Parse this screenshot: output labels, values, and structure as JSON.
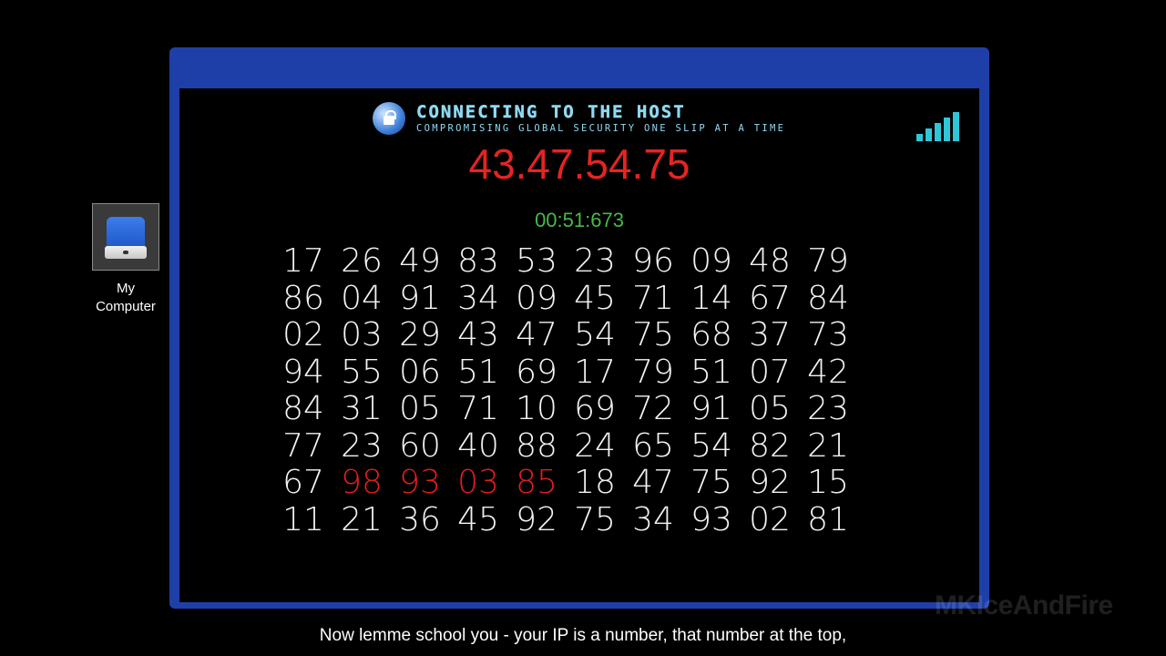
{
  "desktop": {
    "icon_name": "drive-icon",
    "label_line1": "My",
    "label_line2": "Computer"
  },
  "header": {
    "title": "CONNECTING TO THE HOST",
    "subtitle": "COMPROMISING GLOBAL SECURITY ONE SLIP AT A TIME"
  },
  "signal": {
    "bars": 5,
    "color": "#2ec7d8"
  },
  "target_ip": "43.47.54.75",
  "timer": "00:51:673",
  "grid": {
    "rows": [
      [
        "17",
        "26",
        "49",
        "83",
        "53",
        "23",
        "96",
        "09",
        "48",
        "79"
      ],
      [
        "86",
        "04",
        "91",
        "34",
        "09",
        "45",
        "71",
        "14",
        "67",
        "84"
      ],
      [
        "02",
        "03",
        "29",
        "43",
        "47",
        "54",
        "75",
        "68",
        "37",
        "73"
      ],
      [
        "94",
        "55",
        "06",
        "51",
        "69",
        "17",
        "79",
        "51",
        "07",
        "42"
      ],
      [
        "84",
        "31",
        "05",
        "71",
        "10",
        "69",
        "72",
        "91",
        "05",
        "23"
      ],
      [
        "77",
        "23",
        "60",
        "40",
        "88",
        "24",
        "65",
        "54",
        "82",
        "21"
      ],
      [
        "67",
        "98",
        "93",
        "03",
        "85",
        "18",
        "47",
        "75",
        "92",
        "15"
      ],
      [
        "11",
        "21",
        "36",
        "45",
        "92",
        "75",
        "34",
        "93",
        "02",
        "81"
      ]
    ],
    "highlighted": [
      [
        6,
        1
      ],
      [
        6,
        2
      ],
      [
        6,
        3
      ],
      [
        6,
        4
      ]
    ],
    "highlight_color": "#e01e1e"
  },
  "caption": "Now lemme school you - your IP is a number, that number at the top,",
  "watermark": "MKIceAndFire",
  "colors": {
    "frame": "#1f3fa8",
    "ip": "#e52422",
    "timer": "#47b94a",
    "title": "#8fd9f2"
  }
}
